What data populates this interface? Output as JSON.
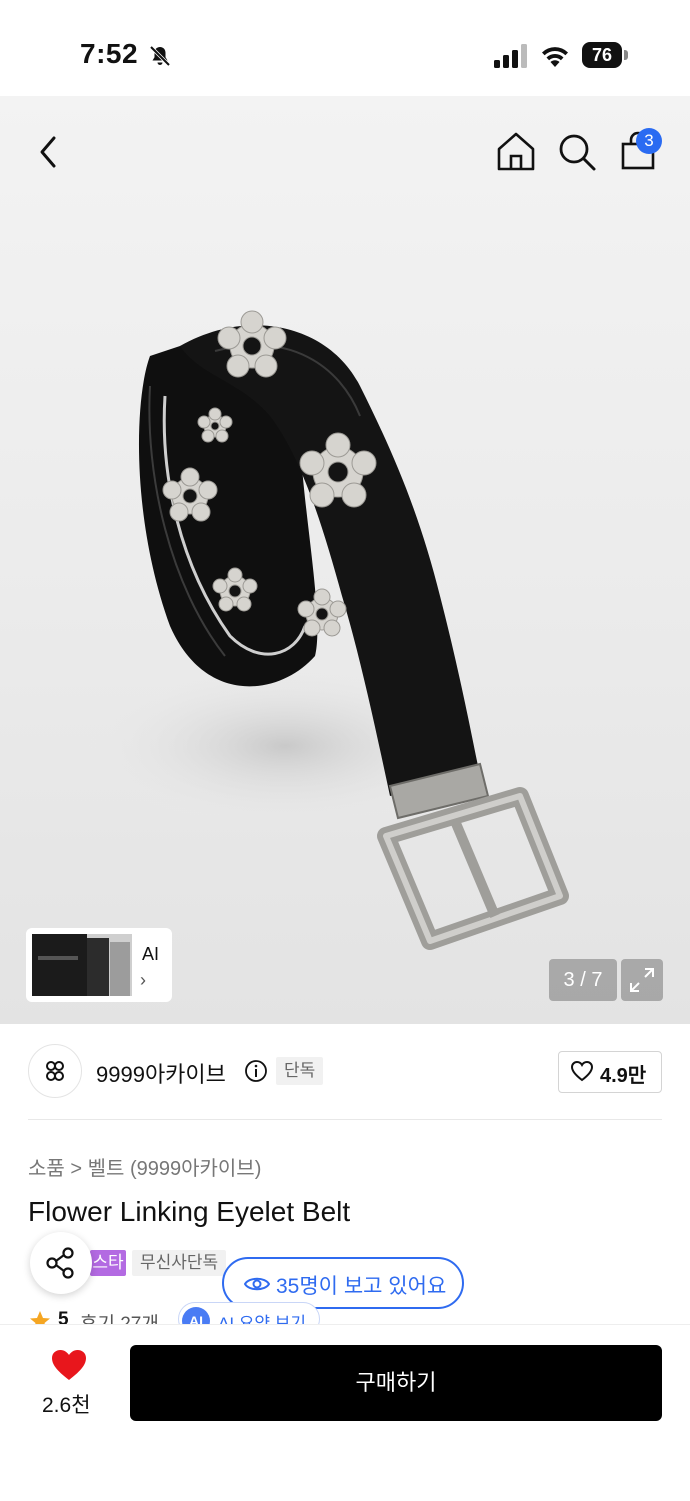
{
  "status_bar": {
    "time": "7:52",
    "battery": "76"
  },
  "header": {
    "cart_count": "3"
  },
  "gallery": {
    "counter": "3 / 7",
    "ai_label": "AI",
    "ai_chevron": "›"
  },
  "brand": {
    "name": "9999아카이브",
    "exclusive_tag": "단독",
    "likes": "4.9만"
  },
  "product": {
    "breadcrumb": "소품 > 벨트 (9999아카이브)",
    "title": "Flower Linking Eyelet Belt",
    "badge_purple": "스타",
    "badge_grey": "무신사단독"
  },
  "viewers": {
    "text": "35명이 보고 있어요"
  },
  "rating": {
    "value": "5",
    "reviews": "후기 27개",
    "ai_summary_label": "AI 요약 보기",
    "ai_badge": "AI"
  },
  "bottom": {
    "wish_count": "2.6천",
    "buy_label": "구매하기"
  },
  "icons": [
    "bell-slash-icon",
    "cellular-signal-icon",
    "wifi-icon",
    "back-chevron-icon",
    "home-icon",
    "search-icon",
    "shopping-bag-icon",
    "expand-icon",
    "info-icon",
    "heart-outline-icon",
    "share-icon",
    "eye-icon",
    "star-icon",
    "heart-filled-icon"
  ],
  "colors": {
    "accent_blue": "#2f6bf0",
    "badge_purple": "#b36ae2",
    "heart_red": "#e8161c",
    "star_orange": "#f5a623"
  }
}
